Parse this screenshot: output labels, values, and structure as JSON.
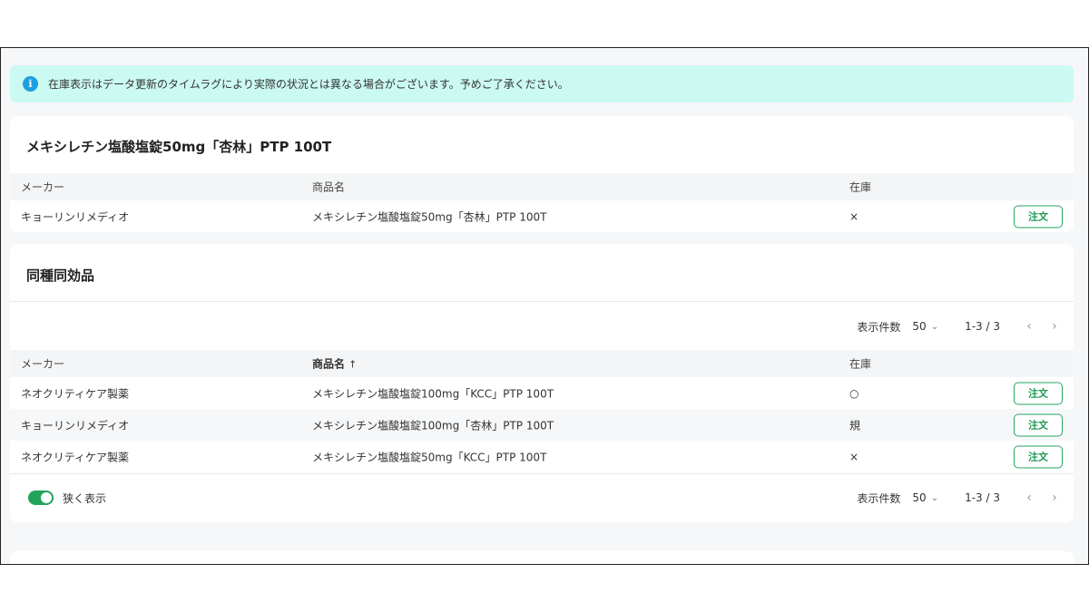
{
  "notice": {
    "icon": "info-icon",
    "text": "在庫表示はデータ更新のタイムラグにより実際の状況とは異なる場合がございます。予めご了承ください。"
  },
  "product": {
    "title": "メキシレチン塩酸塩錠50mg「杏林」PTP 100T",
    "columns": {
      "maker": "メーカー",
      "name": "商品名",
      "stock": "在庫"
    },
    "row": {
      "maker": "キョーリンリメディオ",
      "name": "メキシレチン塩酸塩錠50mg「杏林」PTP 100T",
      "stock": "×",
      "action": "注文"
    }
  },
  "similar": {
    "title": "同種同効品",
    "pager_top": {
      "label": "表示件数",
      "size": "50",
      "range": "1-3 / 3"
    },
    "columns": {
      "maker": "メーカー",
      "name": "商品名",
      "sort_icon": "↑",
      "stock": "在庫"
    },
    "rows": [
      {
        "maker": "ネオクリティケア製薬",
        "name": "メキシレチン塩酸塩錠100mg「KCC」PTP 100T",
        "stock": "○",
        "action": "注文"
      },
      {
        "maker": "キョーリンリメディオ",
        "name": "メキシレチン塩酸塩錠100mg「杏林」PTP 100T",
        "stock": "規",
        "action": "注文"
      },
      {
        "maker": "ネオクリティケア製薬",
        "name": "メキシレチン塩酸塩錠50mg「KCC」PTP 100T",
        "stock": "×",
        "action": "注文"
      }
    ],
    "toggle": {
      "label": "狭く表示",
      "on": true
    },
    "pager_bottom": {
      "label": "表示件数",
      "size": "50",
      "range": "1-3 / 3"
    }
  },
  "colors": {
    "notice_bg": "#cbfaf2",
    "info": "#1e9fe0",
    "accent": "#22a35a"
  }
}
